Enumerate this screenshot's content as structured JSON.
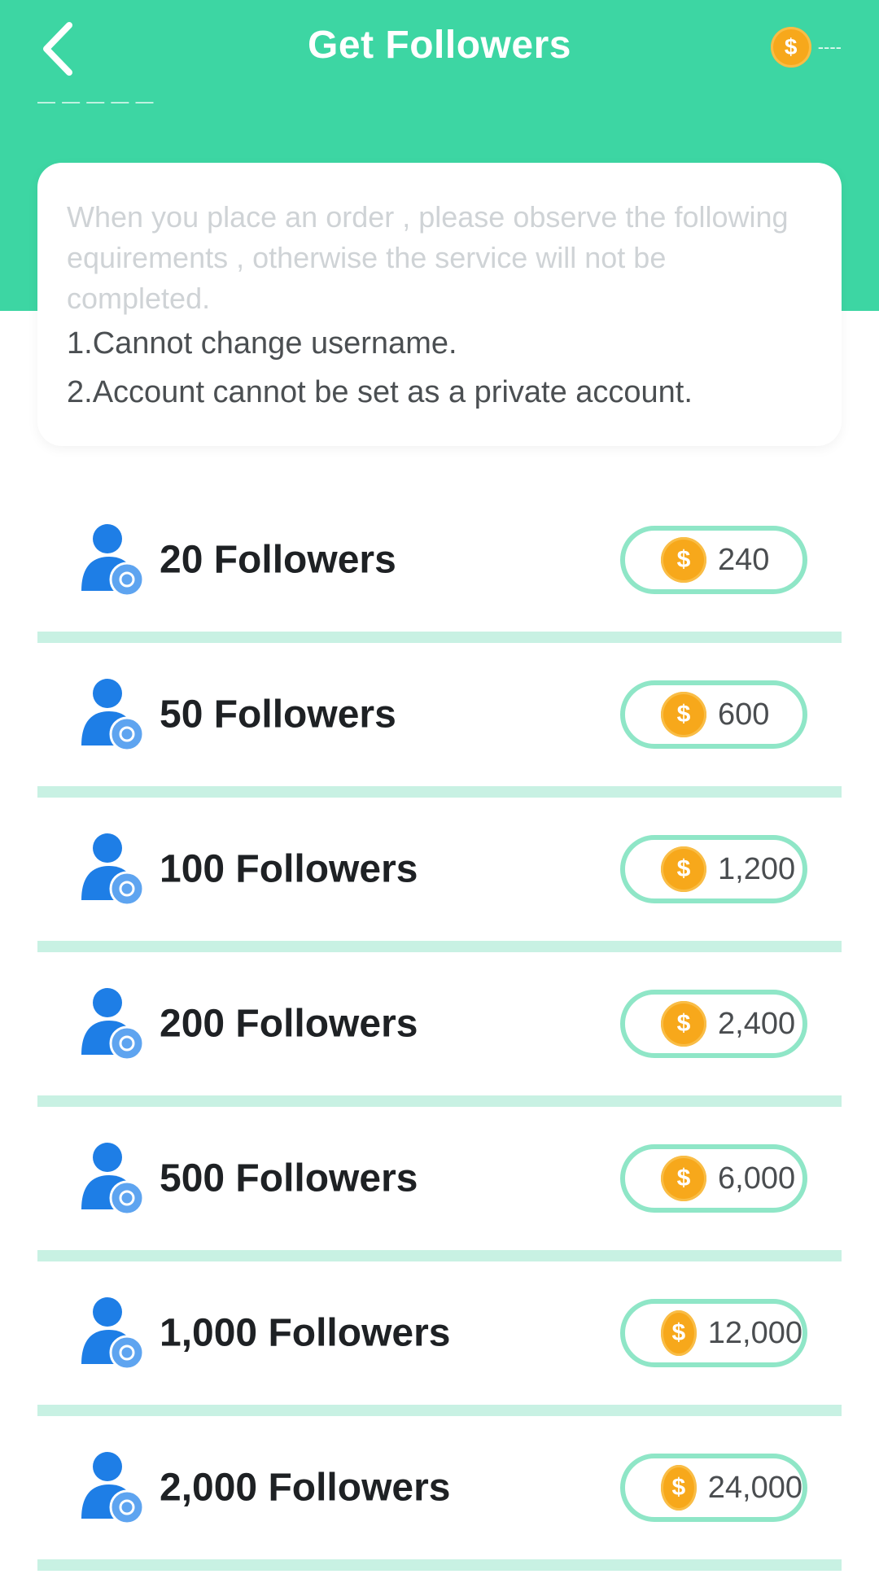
{
  "header": {
    "title": "Get Followers",
    "subtitle": "— — — — —",
    "balance_value": "----"
  },
  "icons": {
    "back": "back-chevron-icon",
    "coin": "coin-dollar-icon",
    "coin_symbol": "$",
    "package": "user-follower-icon"
  },
  "colors": {
    "brand_green": "#3dd6a3",
    "coin_orange": "#f7a81b",
    "user_icon_blue": "#1e7ee6",
    "pill_border": "#8fe6c7"
  },
  "notice": {
    "intro": "When you place an order , please observe the following equirements , otherwise the service will not be completed.",
    "rule_1": "1.Cannot change username.",
    "rule_2": "2.Account cannot be set as a private account."
  },
  "packages": [
    {
      "label": "20 Followers",
      "price": "240"
    },
    {
      "label": "50 Followers",
      "price": "600"
    },
    {
      "label": "100 Followers",
      "price": "1,200"
    },
    {
      "label": "200 Followers",
      "price": "2,400"
    },
    {
      "label": "500 Followers",
      "price": "6,000"
    },
    {
      "label": "1,000 Followers",
      "price": "12,000"
    },
    {
      "label": "2,000 Followers",
      "price": "24,000"
    }
  ]
}
